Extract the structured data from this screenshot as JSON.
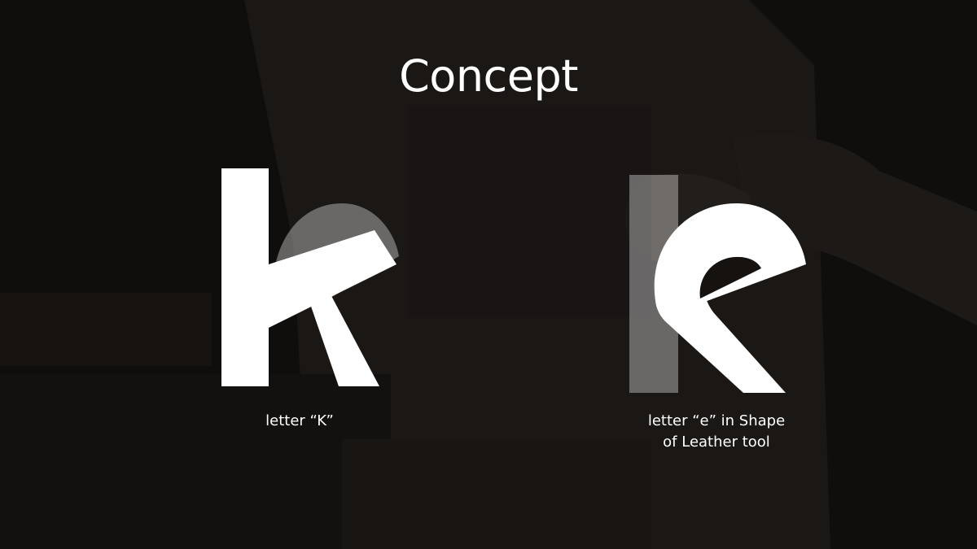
{
  "slide": {
    "title": "Concept"
  },
  "concepts": [
    {
      "icon": "letter-k-glyph",
      "caption_line1": "letter “K”"
    },
    {
      "icon": "letter-e-leather-tool-glyph",
      "caption_line1": "letter “e” in Shape",
      "caption_line2": "of Leather tool"
    }
  ],
  "colors": {
    "background": "#0e0c0b",
    "glyph": "#ffffff",
    "ghost": "#ffffff59",
    "text": "#ffffff"
  }
}
